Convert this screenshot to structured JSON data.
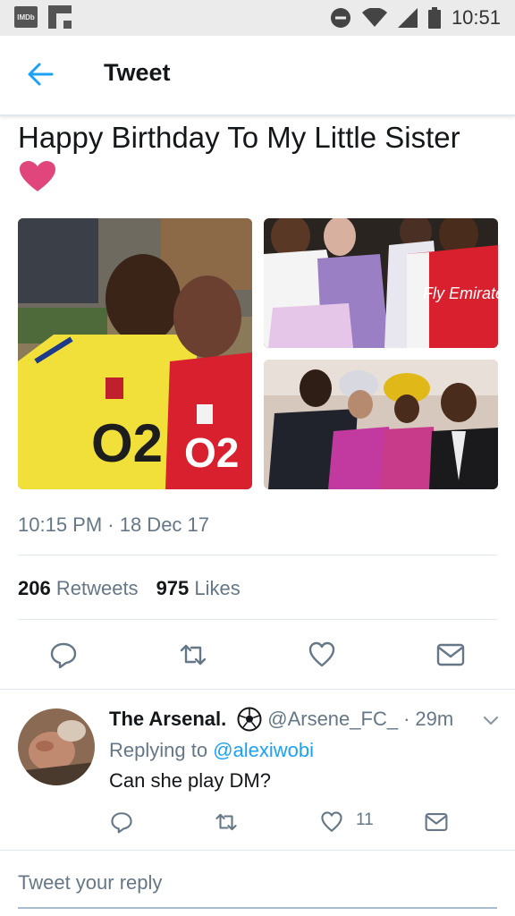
{
  "status_bar": {
    "left_icons": [
      "imdb-icon",
      "flipboard-icon"
    ],
    "right_icons": [
      "do-not-disturb-icon",
      "wifi-icon",
      "signal-icon",
      "battery-icon"
    ],
    "imdb_label": "IMDb",
    "time": "10:51"
  },
  "header": {
    "back_icon": "back-arrow-icon",
    "title": "Tweet"
  },
  "tweet": {
    "text": "Happy Birthday To My Little Sister",
    "emoji": "pink-heart",
    "photos": [
      "photo-kids-arsenal-kits",
      "photo-family-group",
      "photo-family-formal"
    ],
    "photo_texts": {
      "kit_sponsor": "O2",
      "kit_sponsor_2": "Fly Emirates"
    },
    "timestamp": "10:15 PM · 18 Dec 17",
    "retweets": {
      "count": "206",
      "label": "Retweets"
    },
    "likes": {
      "count": "975",
      "label": "Likes"
    }
  },
  "actions": [
    "reply-icon",
    "retweet-icon",
    "like-icon",
    "dm-icon"
  ],
  "reply": {
    "name": "The Arsenal.",
    "badge_icon": "soccer-ball-icon",
    "handle": "@Arsene_FC_",
    "separator": "·",
    "time": "29m",
    "replying_label": "Replying to",
    "replying_to": "@alexiwobi",
    "text": "Can she play DM?",
    "like_count": "11"
  },
  "compose": {
    "placeholder": "Tweet your reply"
  },
  "colors": {
    "accent": "#1da1f2",
    "secondary_text": "#657786",
    "divider": "#e1e8ed",
    "heart": "#e0457b"
  }
}
